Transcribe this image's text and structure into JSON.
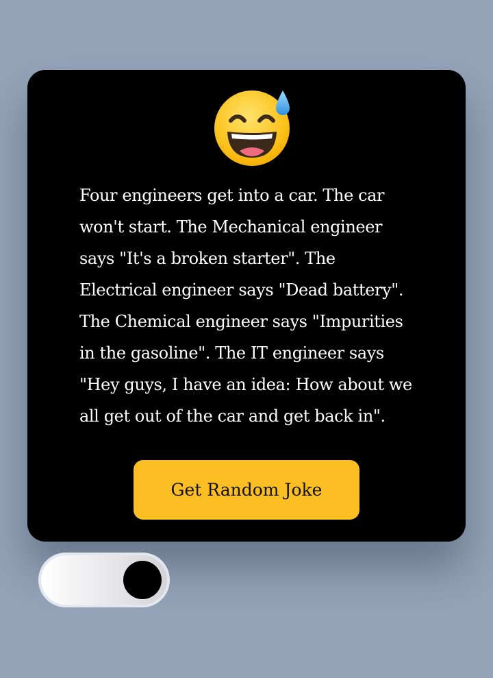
{
  "card": {
    "emoji_icon": "grinning-face-with-sweat-emoji",
    "joke_text": "Four engineers get into a car. The car won't start. The Mechanical engineer says \"It's a broken starter\". The Electrical engineer says \"Dead battery\". The Chemical engineer says \"Impurities in the gasoline\". The IT engineer says \"Hey guys, I have an idea: How about we all get out of the car and get back in\".",
    "button_label": "Get Random Joke"
  },
  "toggle": {
    "state": "on",
    "icon": "toggle-switch"
  },
  "colors": {
    "background": "#94a3b8",
    "card": "#000000",
    "button": "#fbbf24",
    "text": "#ffffff"
  }
}
